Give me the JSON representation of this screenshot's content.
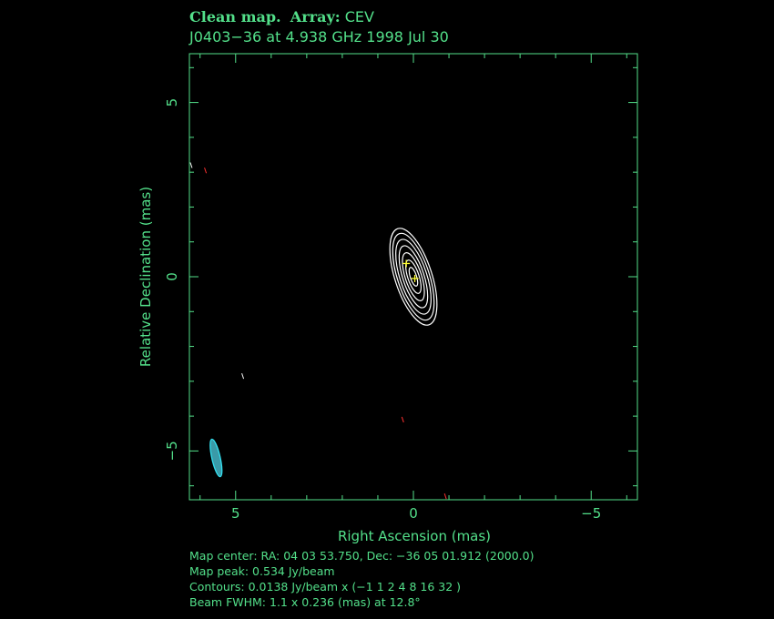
{
  "title": {
    "main_label": "Clean map.",
    "array_label": "Array:",
    "array_value": "CEV",
    "subtitle": "J0403−36 at 4.938 GHz 1998 Jul 30"
  },
  "footer": {
    "map_center": "Map center:  RA: 04 03 53.750,  Dec: −36 05 01.912 (2000.0)",
    "map_peak": "Map peak: 0.534 Jy/beam",
    "contours": "Contours: 0.0138 Jy/beam x (−1 1 2 4 8 16 32 )",
    "beam": "Beam FWHM: 1.1 x 0.236 (mas) at 12.8°"
  },
  "chart_data": {
    "type": "contour",
    "xlabel": "Right Ascension   (mas)",
    "ylabel": "Relative Declination   (mas)",
    "xlim": [
      6.3,
      -6.3
    ],
    "ylim": [
      -6.4,
      6.4
    ],
    "xticks": [
      5,
      0,
      -5
    ],
    "yticks": [
      5,
      0,
      -5
    ],
    "xtick_labels": [
      "5",
      "0",
      "−5"
    ],
    "ytick_labels": [
      "5",
      "0",
      "−5"
    ],
    "contour_levels": [
      -1,
      1,
      2,
      4,
      8,
      16,
      32
    ],
    "source_center": [
      0.0,
      0.0
    ],
    "source_position_angle_deg": 18,
    "contour_semi_axes_mas": [
      [
        0.52,
        1.45
      ],
      [
        0.45,
        1.3
      ],
      [
        0.38,
        1.12
      ],
      [
        0.3,
        0.93
      ],
      [
        0.23,
        0.72
      ],
      [
        0.16,
        0.5
      ],
      [
        0.09,
        0.28
      ]
    ],
    "model_components": [
      {
        "x": 0.2,
        "y": 0.38
      },
      {
        "x": -0.04,
        "y": -0.05
      }
    ],
    "beam": {
      "x": 5.55,
      "y": -5.2,
      "major_mas": 1.1,
      "minor_mas": 0.236,
      "pa_deg": 12.8
    },
    "colors": {
      "axes": "#53e08a",
      "contour": "#ffffff",
      "negative": "#ff3030",
      "model": "#ffff30",
      "beam_fill": "#3a9aa8",
      "beam_edge": "#33e0f0"
    }
  }
}
